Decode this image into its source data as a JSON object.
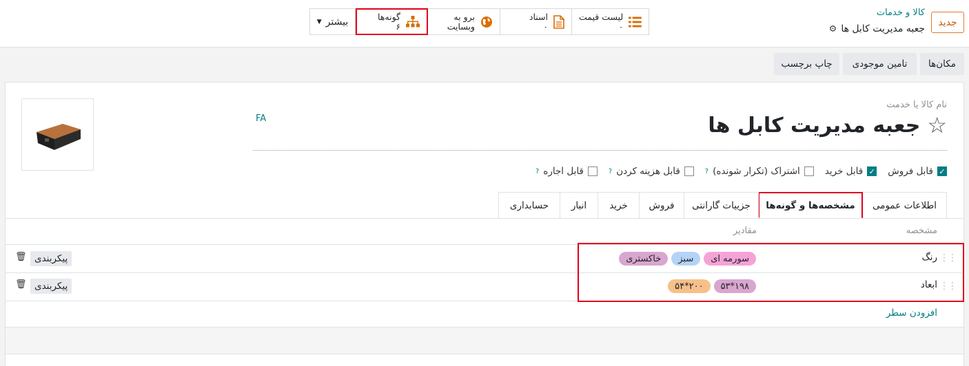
{
  "control": {
    "new_button": "جدید",
    "breadcrumb_parent": "کالا و خدمات",
    "breadcrumb_current": "جعبه مدیریت کابل ها",
    "more_label": "بیشتر"
  },
  "stats": {
    "pricelist": {
      "label": "لیست قیمت",
      "value": "۰"
    },
    "documents": {
      "label": "اسناد",
      "value": "۰"
    },
    "website": {
      "label1": "برو به",
      "label2": "وبسایت"
    },
    "variants": {
      "label": "گونه‌ها",
      "value": "۶"
    }
  },
  "actions": {
    "locations": "مکان‌ها",
    "replenish": "تامین موجودی",
    "print_labels": "چاپ برچسب"
  },
  "form": {
    "name_label": "نام کالا یا خدمت",
    "product_name": "جعبه مدیریت کابل ها",
    "lang": "FA",
    "checkboxes": [
      {
        "label": "قابل فروش",
        "checked": true,
        "help": false
      },
      {
        "label": "قابل خرید",
        "checked": true,
        "help": false
      },
      {
        "label": "اشتراک (تکرار شونده)",
        "checked": false,
        "help": true
      },
      {
        "label": "قابل هزینه کردن",
        "checked": false,
        "help": true
      },
      {
        "label": "قابل اجاره",
        "checked": false,
        "help": true
      }
    ],
    "help_mark": "?"
  },
  "tabs": [
    "اطلاعات عمومی",
    "مشخصه‌ها و گونه‌ها",
    "جزییات گارانتی",
    "فروش",
    "خرید",
    "انبار",
    "حسابداری"
  ],
  "table": {
    "col_attribute": "مشخصه",
    "col_values": "مقادیر",
    "rows": [
      {
        "attribute": "رنگ",
        "values": [
          {
            "label": "سورمه ای",
            "color": "#f5a3d7"
          },
          {
            "label": "سبز",
            "color": "#b5d3f7"
          },
          {
            "label": "خاکستری",
            "color": "#d9a6cf"
          }
        ],
        "configure": "پیکربندی"
      },
      {
        "attribute": "ابعاد",
        "values": [
          {
            "label": "۱۹۸*۵۳",
            "color": "#d9a6cf"
          },
          {
            "label": "۲۰۰*۵۴",
            "color": "#f7c08a"
          }
        ],
        "configure": "پیکربندی"
      }
    ],
    "add_line": "افزودن سطر"
  }
}
